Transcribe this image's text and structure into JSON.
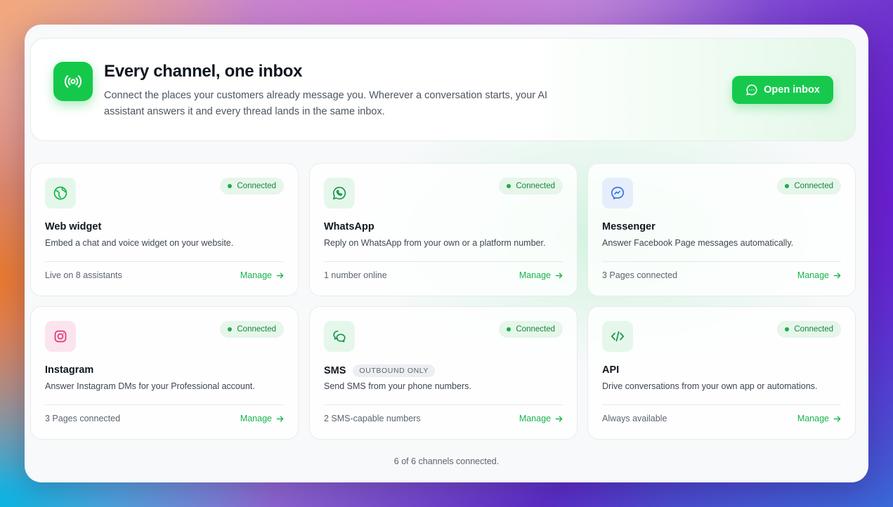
{
  "hero": {
    "icon": "broadcast-icon",
    "title": "Every channel, one inbox",
    "subtitle": "Connect the places your customers already message you. Wherever a conversation starts, your AI assistant answers it and every thread lands in the same inbox.",
    "button_label": "Open inbox",
    "button_icon": "chat-bubble-icon"
  },
  "colors": {
    "accent": "#16c94d",
    "badge_bg": "#e6f6ea",
    "badge_text": "#17853d"
  },
  "channels": [
    {
      "name": "Web widget",
      "icon": "globe-icon",
      "status": "Connected",
      "description": "Embed a chat and voice widget on your website.",
      "footer": "Live on 8 assistants",
      "action": "Manage"
    },
    {
      "name": "WhatsApp",
      "icon": "whatsapp-icon",
      "status": "Connected",
      "description": "Reply on WhatsApp from your own or a platform number.",
      "footer": "1 number online",
      "action": "Manage"
    },
    {
      "name": "Messenger",
      "icon": "messenger-icon",
      "status": "Connected",
      "description": "Answer Facebook Page messages automatically.",
      "footer": "3 Pages connected",
      "action": "Manage"
    },
    {
      "name": "Instagram",
      "icon": "instagram-icon",
      "status": "Connected",
      "description": "Answer Instagram DMs for your Professional account.",
      "footer": "3 Pages connected",
      "action": "Manage"
    },
    {
      "name": "SMS",
      "tag": "OUTBOUND ONLY",
      "icon": "sms-icon",
      "status": "Connected",
      "description": "Send SMS from your phone numbers.",
      "footer": "2 SMS-capable numbers",
      "action": "Manage"
    },
    {
      "name": "API",
      "icon": "code-icon",
      "status": "Connected",
      "description": "Drive conversations from your own app or automations.",
      "footer": "Always available",
      "action": "Manage"
    }
  ],
  "footer_note": "6 of 6 channels connected."
}
